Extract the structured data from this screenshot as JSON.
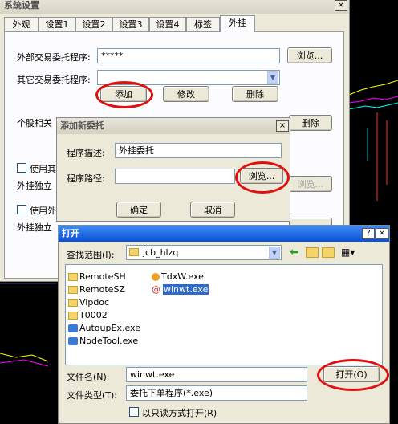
{
  "main_dialog": {
    "title": "系统设置",
    "tabs": [
      "外观",
      "设置1",
      "设置2",
      "设置3",
      "设置4",
      "标签",
      "外挂"
    ],
    "ext_trade_label": "外部交易委托程序:",
    "ext_trade_value": "*****",
    "browse_label": "浏览...",
    "other_trade_label": "其它交易委托程序:",
    "add_label": "添加",
    "modify_label": "修改",
    "delete_label": "删除",
    "stock_label": "个股相关",
    "delete2_label": "删除",
    "use1_label": "使用其",
    "ext_indep1_label": "外挂独立",
    "browse2_label": "浏览...",
    "use2_label": "使用外",
    "ext_indep2_label": "外挂独立"
  },
  "add_dialog": {
    "title": "添加新委托",
    "desc_label": "程序描述:",
    "desc_value": "外挂委托",
    "path_label": "程序路径:",
    "path_value": "",
    "browse_label": "浏览...",
    "ok_label": "确定",
    "cancel_label": "取消",
    "close_glyph": "×"
  },
  "open_dialog": {
    "title": "打开",
    "help_glyph": "?",
    "close_glyph": "×",
    "lookin_label": "查找范围(I):",
    "lookin_value": "jcb_hlzq",
    "files": [
      {
        "name": "RemoteSH",
        "type": "folder"
      },
      {
        "name": "RemoteSZ",
        "type": "folder"
      },
      {
        "name": "Vipdoc",
        "type": "folder"
      },
      {
        "name": "T0002",
        "type": "folder"
      },
      {
        "name": "AutoupEx.exe",
        "type": "exe"
      },
      {
        "name": "NodeTool.exe",
        "type": "exe"
      }
    ],
    "files_col2": [
      {
        "name": "TdxW.exe",
        "type": "exe"
      },
      {
        "name": "winwt.exe",
        "type": "exe",
        "selected": true
      }
    ],
    "filename_label": "文件名(N):",
    "filename_value": "winwt.exe",
    "filetype_label": "文件类型(T):",
    "filetype_value": "委托下单程序(*.exe)",
    "readonly_label": "以只读方式打开(R)",
    "open_label": "打开(O)"
  },
  "colors": {
    "highlight_red": "#e01010",
    "dialog_bg": "#ece9d8",
    "selection_blue": "#316ac5"
  }
}
